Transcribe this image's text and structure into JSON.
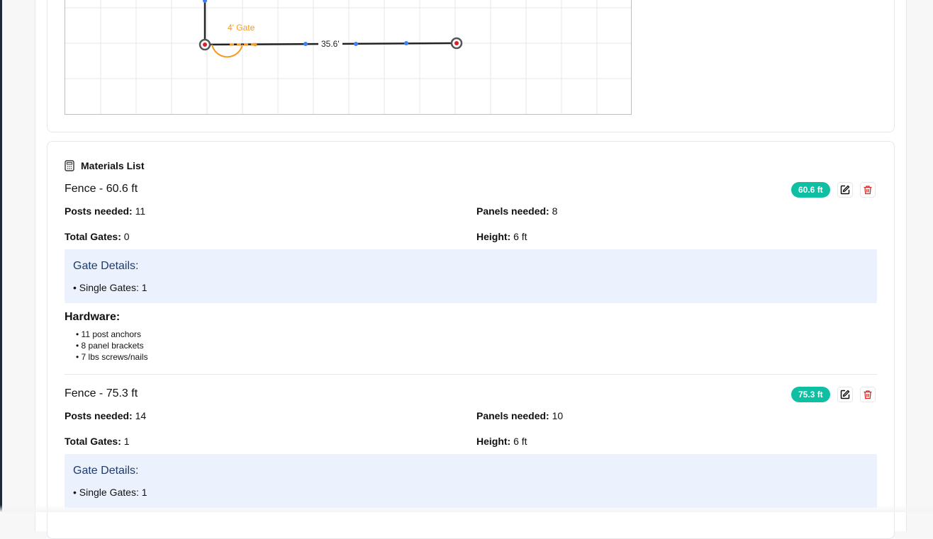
{
  "drawing": {
    "gate_label": "4' Gate",
    "segment_label": "35.6'"
  },
  "materials": {
    "title": "Materials List",
    "fences": [
      {
        "title": "Fence - 60.6 ft",
        "badge": "60.6 ft",
        "posts_label": "Posts needed:",
        "posts_value": "11",
        "panels_label": "Panels needed:",
        "panels_value": "8",
        "gates_label": "Total Gates:",
        "gates_value": "0",
        "height_label": "Height:",
        "height_value": "6 ft",
        "gate_details_title": "Gate Details:",
        "gate_details_items": [
          "• Single Gates: 1"
        ],
        "hardware_title": "Hardware:",
        "hardware_items": [
          "• 11 post anchors",
          "• 8 panel brackets",
          "• 7 lbs screws/nails"
        ]
      },
      {
        "title": "Fence - 75.3 ft",
        "badge": "75.3 ft",
        "posts_label": "Posts needed:",
        "posts_value": "14",
        "panels_label": "Panels needed:",
        "panels_value": "10",
        "gates_label": "Total Gates:",
        "gates_value": "1",
        "height_label": "Height:",
        "height_value": "6 ft",
        "gate_details_title": "Gate Details:",
        "gate_details_items": [
          "• Single Gates: 1"
        ]
      }
    ]
  },
  "colors": {
    "badge": "#0fbfa3",
    "gate_orange": "#f59a23",
    "node_red": "#e11d2e",
    "delete_red": "#dc2626",
    "gate_box_bg": "#ebf2fe"
  },
  "icons": {
    "materials": "calculator-icon",
    "edit": "edit-icon",
    "delete": "trash-icon"
  }
}
